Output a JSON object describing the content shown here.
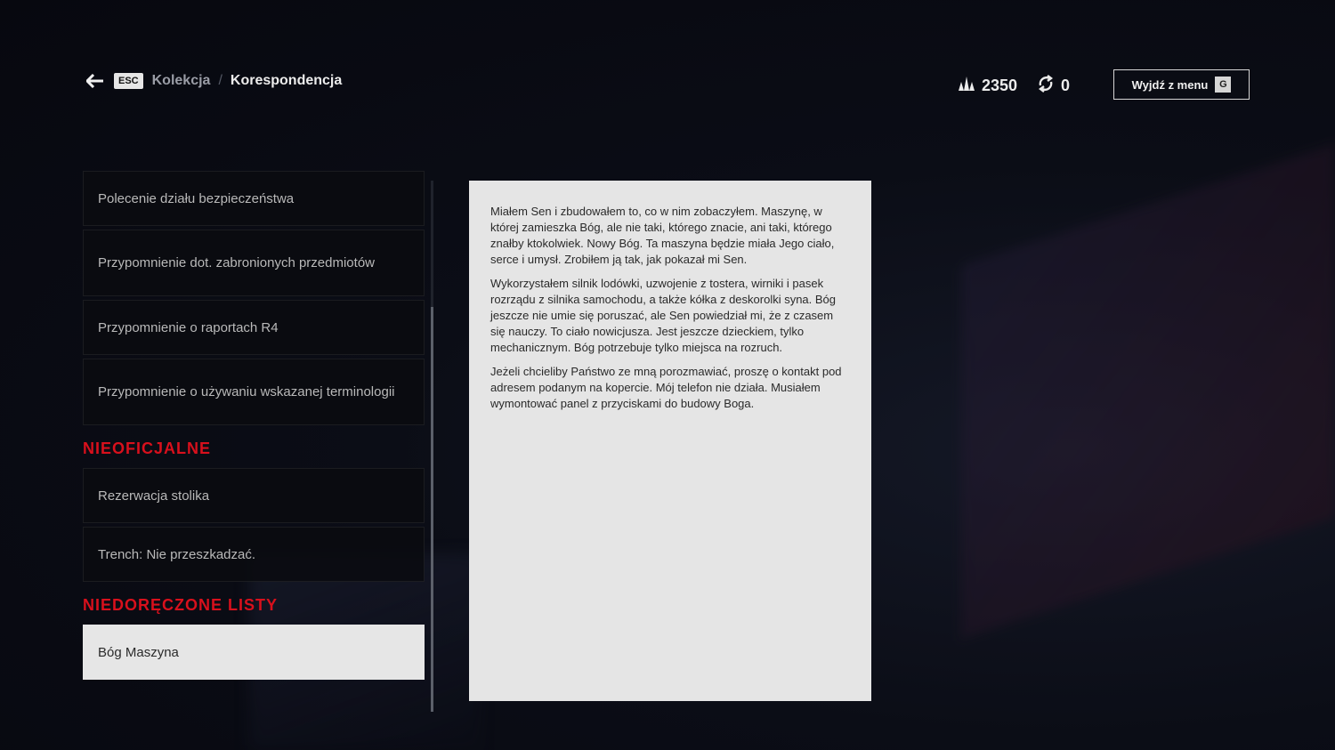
{
  "header": {
    "esc_key": "ESC",
    "breadcrumb_parent": "Kolekcja",
    "breadcrumb_separator": "/",
    "breadcrumb_current": "Korespondencja",
    "merit_points": "2350",
    "sync_count": "0",
    "exit_label": "Wyjdź z menu",
    "exit_key": "G"
  },
  "list": {
    "official_items": [
      "Polecenie działu bezpieczeństwa",
      "Przypomnienie dot. zabronionych przedmiotów",
      "Przypomnienie o raportach R4",
      "Przypomnienie o używaniu wskazanej terminologii"
    ],
    "unofficial_title": "NIEOFICJALNE",
    "unofficial_items": [
      "Rezerwacja stolika",
      "Trench: Nie przeszkadzać."
    ],
    "undelivered_title": "NIEDORĘCZONE LISTY",
    "undelivered_items": [
      "Bóg Maszyna"
    ]
  },
  "letter": {
    "paragraphs": [
      "Miałem Sen i zbudowałem to, co w nim zobaczyłem. Maszynę, w której zamieszka Bóg, ale nie taki, którego znacie, ani taki, którego znałby ktokolwiek. Nowy Bóg. Ta maszyna będzie miała Jego ciało, serce i umysł. Zrobiłem ją tak, jak pokazał mi Sen.",
      "Wykorzystałem silnik lodówki, uzwojenie z tostera, wirniki i pasek rozrządu z silnika samochodu, a także kółka z deskorolki syna. Bóg jeszcze nie umie się poruszać, ale Sen powiedział mi, że z czasem się nauczy. To ciało nowicjusza. Jest jeszcze dzieckiem, tylko mechanicznym. Bóg potrzebuje tylko miejsca na rozruch.",
      "Jeżeli chcieliby Państwo ze mną porozmawiać, proszę o kontakt pod adresem podanym na kopercie. Mój telefon nie działa. Musiałem wymontować panel z przyciskami do budowy Boga."
    ]
  },
  "colors": {
    "accent_red": "#d8101c",
    "letter_paper": "#e5e5e5",
    "selected_item": "#e6e6e6"
  },
  "icons": {
    "back": "arrow-left-icon",
    "merits": "merit-icon",
    "sync": "sync-icon"
  }
}
